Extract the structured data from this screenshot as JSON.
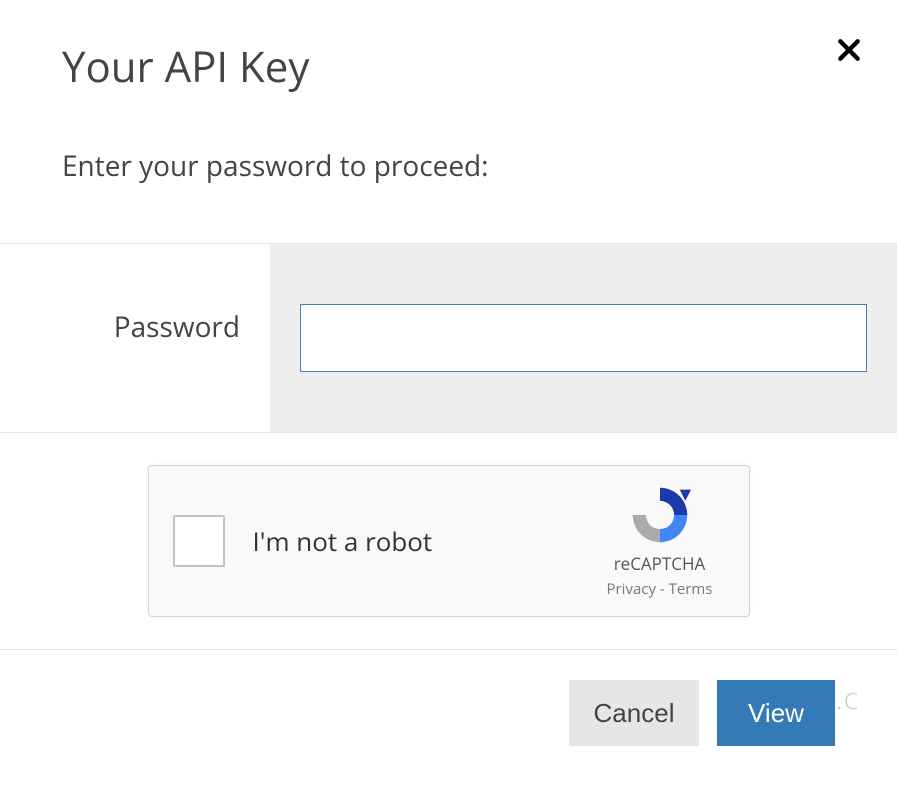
{
  "modal": {
    "title": "Your API Key",
    "subtitle": "Enter your password to proceed:"
  },
  "form": {
    "password_label": "Password",
    "password_value": ""
  },
  "captcha": {
    "label": "I'm not a robot",
    "brand": "reCAPTCHA",
    "privacy": "Privacy",
    "sep": " - ",
    "terms": "Terms"
  },
  "footer": {
    "cancel": "Cancel",
    "view": "View"
  },
  "watermark": "oucl.c"
}
